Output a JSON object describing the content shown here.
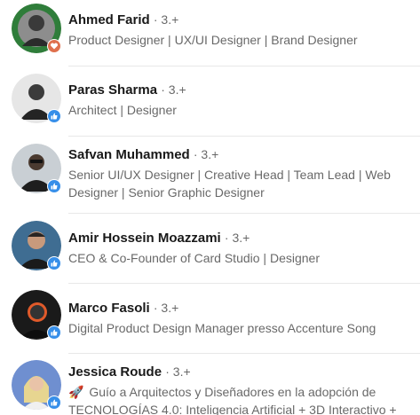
{
  "reactions": [
    {
      "name": "Ahmed Farid",
      "degree": "· 3.+",
      "headline": "Product Designer | UX/UI Designer | Brand Designer",
      "reaction": "love",
      "reaction_color": "#df704d"
    },
    {
      "name": "Paras Sharma",
      "degree": "· 3.+",
      "headline": "Architect | Designer",
      "reaction": "like",
      "reaction_color": "#378fe9"
    },
    {
      "name": "Safvan Muhammed",
      "degree": "· 3.+",
      "headline": "Senior UI/UX Designer | Creative Head | Team Lead | Web Designer | Senior Graphic Designer",
      "reaction": "like",
      "reaction_color": "#378fe9"
    },
    {
      "name": "Amir Hossein Moazzami",
      "degree": "· 3.+",
      "headline": "CEO & Co-Founder of Card Studio | Designer",
      "reaction": "like",
      "reaction_color": "#378fe9"
    },
    {
      "name": "Marco Fasoli",
      "degree": "· 3.+",
      "headline": "Digital Product Design Manager presso Accenture Song",
      "reaction": "like",
      "reaction_color": "#378fe9"
    },
    {
      "name": "Jessica Roude",
      "degree": "· 3.+",
      "headline_emoji": "🚀",
      "headline": "Guío a Arquitectos y Diseñadores en la adopción de TECNOLOGÍAS 4.0: Inteligencia Artificial + 3D Interactivo +",
      "reaction": "like",
      "reaction_color": "#378fe9"
    }
  ]
}
